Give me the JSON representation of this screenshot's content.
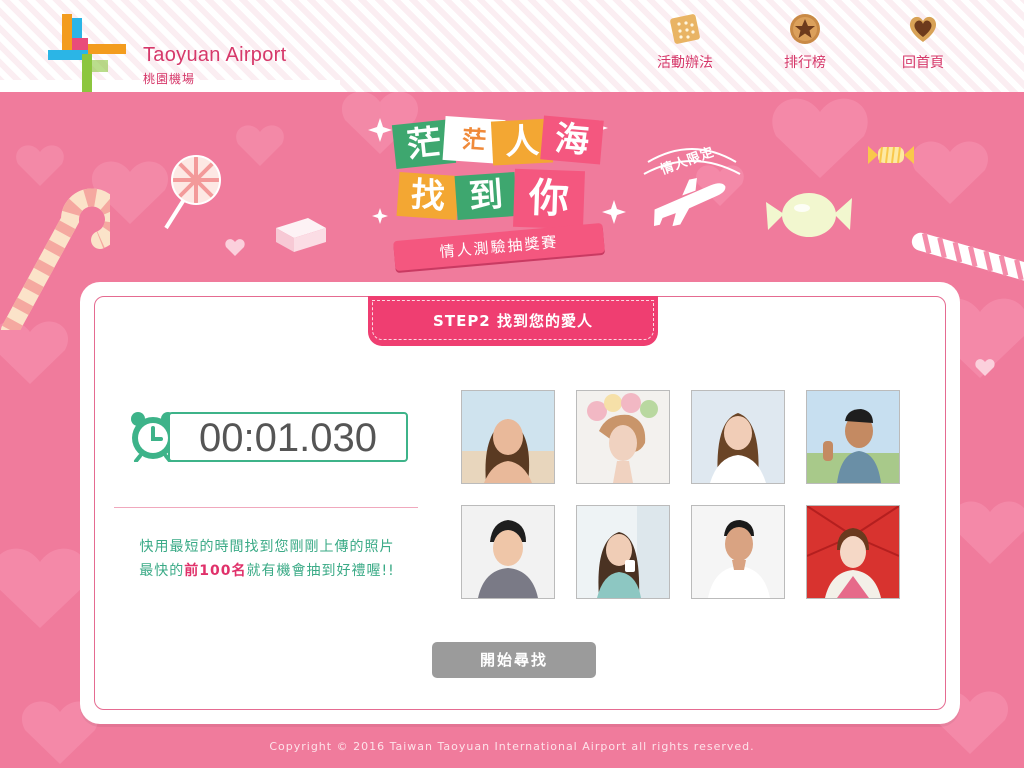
{
  "brand": {
    "name_en": "Taoyuan Airport",
    "name_zh": "桃園機場"
  },
  "nav": [
    {
      "label": "活動辦法",
      "icon": "cracker-icon"
    },
    {
      "label": "排行榜",
      "icon": "star-cookie-icon"
    },
    {
      "label": "回首頁",
      "icon": "heart-cookie-icon"
    }
  ],
  "title": {
    "chars": [
      "茫",
      "茫",
      "人",
      "海",
      "找",
      "到",
      "你"
    ],
    "subtitle": "情人測驗抽獎賽",
    "stamp": "情人限定"
  },
  "step": {
    "label": "STEP2  找到您的愛人"
  },
  "timer": {
    "value": "00:01.030"
  },
  "instructions": {
    "line1": "快用最短的時間找到您剛剛上傳的照片",
    "line2_pre": "最快的",
    "line2_highlight": "前100名",
    "line2_post": "就有機會抽到好禮喔!!"
  },
  "start_button": {
    "label": "開始尋找"
  },
  "footer": {
    "copyright": "Copyright © 2016 Taiwan Taoyuan International Airport all rights reserved."
  },
  "colors": {
    "accent": "#ef3e71",
    "timer_green": "#3db389",
    "background": "#f07b9c",
    "button_disabled": "#9b9b9b"
  }
}
